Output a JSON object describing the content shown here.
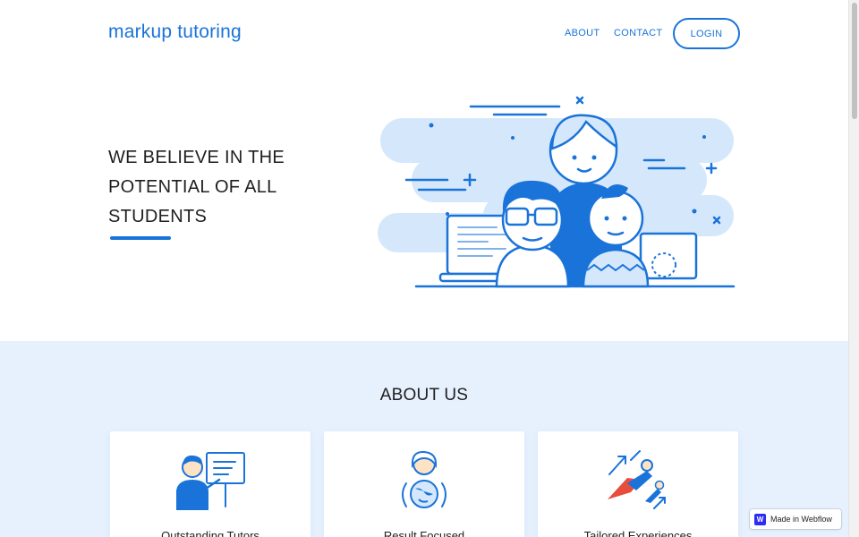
{
  "header": {
    "brand": "markup tutoring",
    "nav": {
      "about": "ABOUT",
      "contact": "CONTACT"
    },
    "login_label": "LOGIN"
  },
  "hero": {
    "title": "WE BELIEVE IN THE POTENTIAL OF ALL STUDENTS"
  },
  "about": {
    "title": "ABOUT US",
    "cards": [
      {
        "label": "Outstanding Tutors",
        "icon": "teacher-board-icon"
      },
      {
        "label": "Result Focused",
        "icon": "globe-person-icon"
      },
      {
        "label": "Tailored Experiences",
        "icon": "superhero-rocket-icon"
      }
    ]
  },
  "badge": {
    "text": "Made in Webflow",
    "logo": "W"
  },
  "colors": {
    "accent": "#1a73d9",
    "light_accent": "#d5e8fb",
    "section_bg": "#e6f1fd"
  }
}
